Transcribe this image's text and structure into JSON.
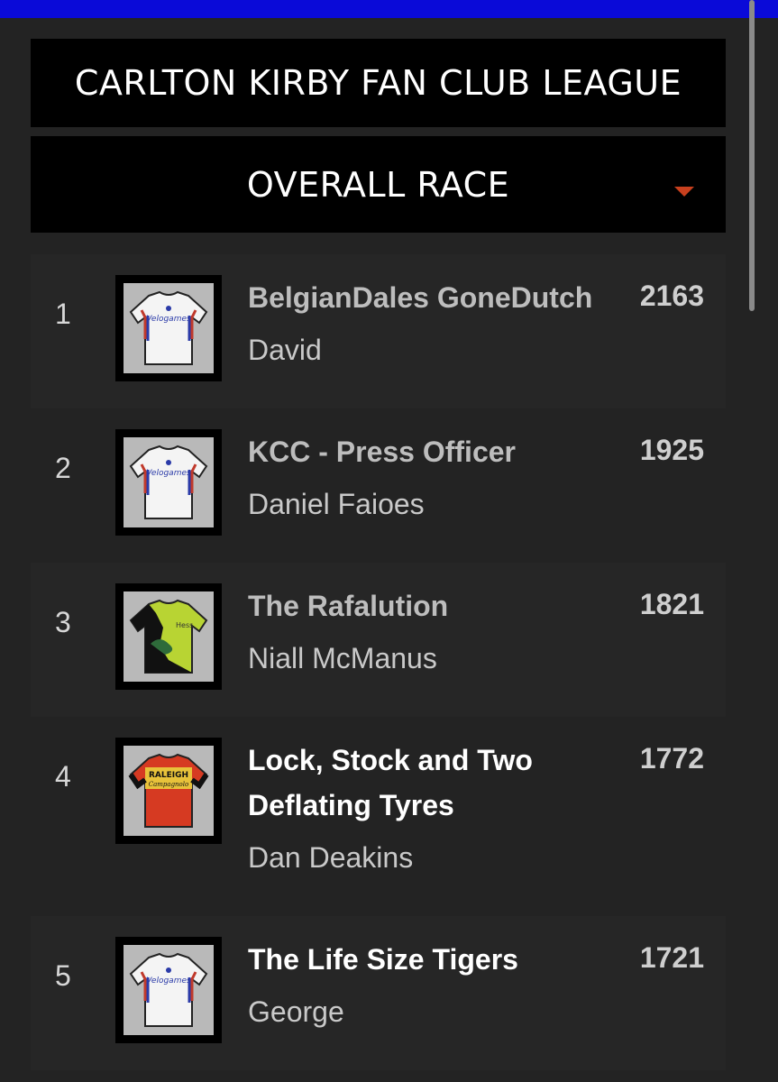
{
  "header": {
    "league_title": "CARLTON KIRBY FAN CLUB LEAGUE",
    "race_select": "OVERALL RACE"
  },
  "colors": {
    "top_bar": "#0a0ad8",
    "caret": "#c8401e",
    "panel": "#000000",
    "background": "#232323"
  },
  "standings": [
    {
      "rank": "1",
      "team": "BelgianDales GoneDutch",
      "manager": "David",
      "points": "2163",
      "jersey": "velogames-white-jersey-icon"
    },
    {
      "rank": "2",
      "team": "KCC - Press Officer",
      "manager": "Daniel Faioes",
      "points": "1925",
      "jersey": "velogames-white-jersey-icon"
    },
    {
      "rank": "3",
      "team": "The Rafalution",
      "manager": "Niall McManus",
      "points": "1821",
      "jersey": "green-black-jersey-icon"
    },
    {
      "rank": "4",
      "team": "Lock, Stock and Two Deflating Tyres",
      "manager": "Dan Deakins",
      "points": "1772",
      "jersey": "raleigh-red-yellow-jersey-icon"
    },
    {
      "rank": "5",
      "team": "The Life Size Tigers",
      "manager": "George",
      "points": "1721",
      "jersey": "velogames-white-jersey-icon"
    }
  ]
}
